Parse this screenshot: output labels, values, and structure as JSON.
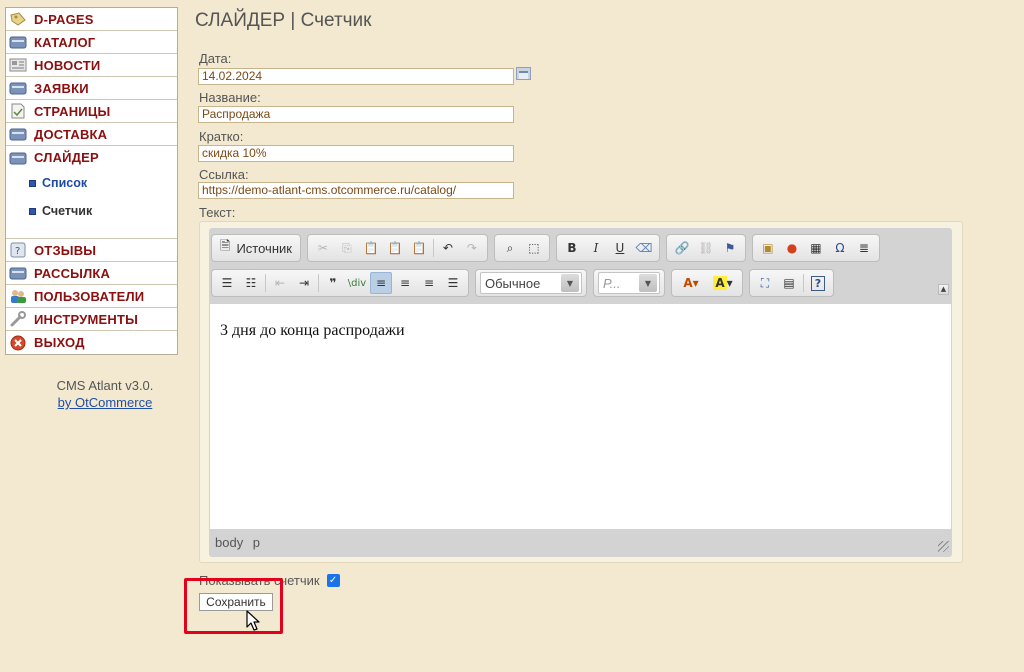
{
  "sidebar": {
    "items": [
      {
        "label": "D-PAGES"
      },
      {
        "label": "КАТАЛОГ"
      },
      {
        "label": "НОВОСТИ"
      },
      {
        "label": "ЗАЯВКИ"
      },
      {
        "label": "СТРАНИЦЫ"
      },
      {
        "label": "ДОСТАВКА"
      },
      {
        "label": "СЛАЙДЕР"
      }
    ],
    "sub_items": [
      {
        "label": "Список"
      },
      {
        "label": "Счетчик"
      }
    ],
    "items_after": [
      {
        "label": "ОТЗЫВЫ"
      },
      {
        "label": "РАССЫЛКА"
      },
      {
        "label": "ПОЛЬЗОВАТЕЛИ"
      },
      {
        "label": "ИНСТРУМЕНТЫ"
      },
      {
        "label": "ВЫХОД"
      }
    ]
  },
  "footer": {
    "version": "CMS Atlant v3.0.",
    "by": "by OtCommerce"
  },
  "page": {
    "title": "СЛАЙДЕР | Счетчик"
  },
  "form": {
    "date_label": "Дата:",
    "date_value": "14.02.2024",
    "name_label": "Название:",
    "name_value": "Распродажа",
    "short_label": "Кратко:",
    "short_value": "скидка 10%",
    "link_label": "Ссылка:",
    "link_value": "https://demo-atlant-cms.otcommerce.ru/catalog/",
    "text_label": "Текст:",
    "show_counter_label": "Показывать счетчик",
    "show_counter_checked": true,
    "save_label": "Сохранить"
  },
  "editor": {
    "source_label": "Источник",
    "format_value": "Обычное",
    "font_value": "Р...",
    "content": "3 дня до конца распродажи",
    "path": "body p"
  },
  "colors": {
    "background": "#f2e9d0",
    "menu_text": "#8b0f0f",
    "submenu_text": "#1f4aa3",
    "highlight": "#e3001b"
  }
}
